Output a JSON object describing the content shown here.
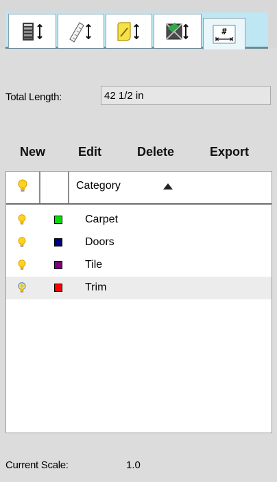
{
  "toolbar": {
    "tabs": [
      {
        "icon": "layers-sort-icon",
        "active": false
      },
      {
        "icon": "ruler-sort-icon",
        "active": false
      },
      {
        "icon": "note-sort-icon",
        "active": false
      },
      {
        "icon": "area-sort-icon",
        "active": false
      },
      {
        "icon": "measure-grid-icon",
        "active": true
      }
    ]
  },
  "total": {
    "label": "Total Length:",
    "value": "42 1/2 in"
  },
  "actions": {
    "new": "New",
    "edit": "Edit",
    "delete": "Delete",
    "export": "Export"
  },
  "list": {
    "header": {
      "visibility_icon": "lightbulb-icon",
      "category": "Category",
      "sort": "ascending"
    },
    "rows": [
      {
        "name": "Carpet",
        "color": "#00e000",
        "visible": true,
        "selected": false
      },
      {
        "name": "Doors",
        "color": "#000080",
        "visible": true,
        "selected": false
      },
      {
        "name": "Tile",
        "color": "#800080",
        "visible": true,
        "selected": false
      },
      {
        "name": "Trim",
        "color": "#ff0000",
        "visible": true,
        "selected": true
      }
    ]
  },
  "scale": {
    "label": "Current Scale:",
    "value": "1.0"
  }
}
